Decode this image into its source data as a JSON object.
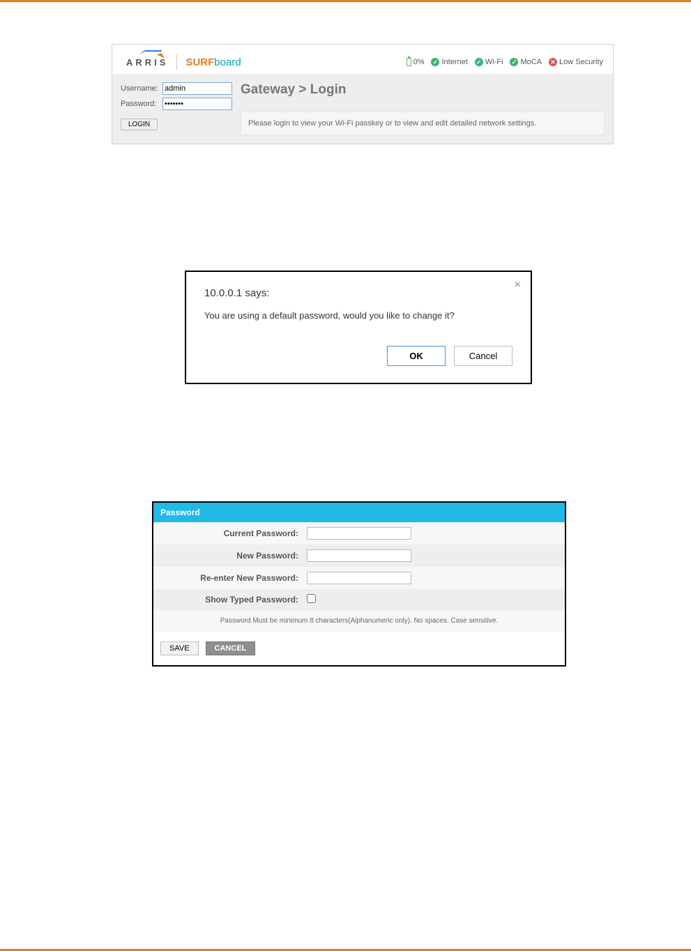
{
  "login_panel": {
    "logo_arris": "ARRIS",
    "logo_surf1": "SURF",
    "logo_surf2": "board",
    "status": {
      "battery": "0%",
      "items": [
        {
          "icon": "ok",
          "label": "Internet"
        },
        {
          "icon": "ok",
          "label": "Wi-Fi"
        },
        {
          "icon": "ok",
          "label": "MoCA"
        },
        {
          "icon": "bad",
          "label": "Low Security"
        }
      ]
    },
    "username_label": "Username:",
    "username_value": "admin",
    "password_label": "Password:",
    "password_value": "•••••••",
    "login_button": "LOGIN",
    "breadcrumb": "Gateway > Login",
    "message": "Please login to view your Wi-Fi passkey or to view and edit detailed network settings."
  },
  "dialog": {
    "title": "10.0.0.1 says:",
    "message": "You are using a default password, would you like to change it?",
    "ok": "OK",
    "cancel": "Cancel",
    "close": "×"
  },
  "password_form": {
    "header": "Password",
    "rows": {
      "current": "Current Password:",
      "new": "New Password:",
      "reenter": "Re-enter New Password:",
      "show": "Show Typed Password:"
    },
    "hint": "Password Must be minimum 8 characters(Alphanumeric only). No spaces. Case sensitive.",
    "save": "SAVE",
    "cancel": "CANCEL"
  }
}
